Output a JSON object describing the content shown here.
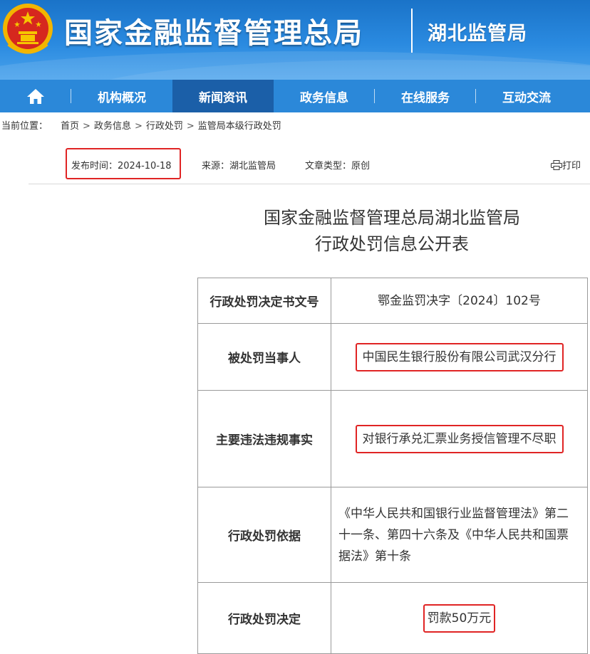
{
  "header": {
    "site_title": "国家金融监督管理总局",
    "sub_title": "湖北监管局",
    "emblem_icon": "national-emblem-icon"
  },
  "nav": {
    "home_icon": "home-icon",
    "items": [
      {
        "label": "机构概况"
      },
      {
        "label": "新闻资讯",
        "active": true
      },
      {
        "label": "政务信息"
      },
      {
        "label": "在线服务"
      },
      {
        "label": "互动交流"
      }
    ],
    "colors": {
      "bar": "#2b88d9",
      "active": "#1b5fa8"
    }
  },
  "breadcrumb": {
    "prefix": "当前位置：",
    "items": [
      "首页",
      "政务信息",
      "行政处罚",
      "监管局本级行政处罚"
    ],
    "separator": ">"
  },
  "meta": {
    "publish_time": "发布时间：2024-10-18",
    "source": "来源：湖北监管局",
    "article_type": "文章类型：原创",
    "print_label": "打印",
    "print_icon": "printer-icon"
  },
  "article": {
    "title_line1": "国家金融监督管理总局湖北监管局",
    "title_line2": "行政处罚信息公开表"
  },
  "table": {
    "rows": [
      {
        "label": "行政处罚决定书文号",
        "value": "鄂金监罚决字〔2024〕102号"
      },
      {
        "label": "被处罚当事人",
        "value": "中国民生银行股份有限公司武汉分行"
      },
      {
        "label": "主要违法违规事实",
        "value": "对银行承兑汇票业务授信管理不尽职"
      },
      {
        "label": "行政处罚依据",
        "value": "《中华人民共和国银行业监督管理法》第二十一条、第四十六条及《中华人民共和国票据法》第十条"
      },
      {
        "label": "行政处罚决定",
        "value": "罚款50万元"
      }
    ]
  },
  "highlight_color": "#e02424"
}
